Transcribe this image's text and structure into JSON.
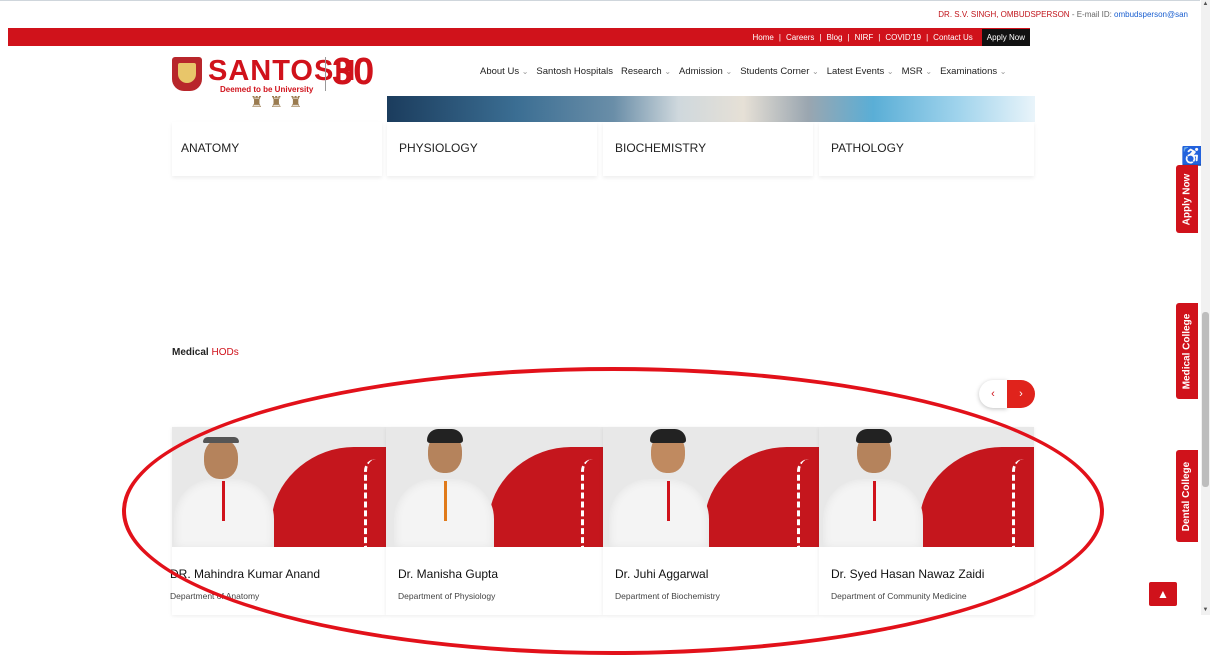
{
  "topinfo": {
    "ombudsperson": "DR. S.V. SINGH, OMBUDSPERSON",
    "email_label": "- E-mail ID:",
    "email": "ombudsperson@san"
  },
  "topnav": {
    "links": [
      "Home",
      "Careers",
      "Blog",
      "NIRF",
      "COVID'19",
      "Contact Us"
    ],
    "apply": "Apply Now"
  },
  "logo": {
    "name": "SANTOSH",
    "subtitle": "Deemed to be University",
    "anniversary": "30"
  },
  "mainnav": {
    "items": [
      "About Us",
      "Santosh Hospitals",
      "Research",
      "Admission",
      "Students Corner",
      "Latest Events",
      "MSR",
      "Examinations"
    ]
  },
  "departments": [
    "ANATOMY",
    "PHYSIOLOGY",
    "BIOCHEMISTRY",
    "PATHOLOGY"
  ],
  "hods": {
    "title_prefix": "Medical",
    "title_accent": "HODs",
    "prev_icon": "chevron-left-icon",
    "next_icon": "chevron-right-icon",
    "doctors": [
      {
        "name": "DR. Mahindra Kumar Anand",
        "department": "Department of Anatomy"
      },
      {
        "name": "Dr. Manisha Gupta",
        "department": "Department of Physiology"
      },
      {
        "name": "Dr. Juhi Aggarwal",
        "department": "Department of Biochemistry"
      },
      {
        "name": "Dr. Syed Hasan Nawaz Zaidi",
        "department": "Department of Community Medicine"
      }
    ]
  },
  "sidetabs": {
    "apply": "Apply Now",
    "medical": "Medical College",
    "dental": "Dental College"
  },
  "icons": {
    "accessibility": "accessibility-icon",
    "scroll_top": "arrow-up-icon"
  },
  "colors": {
    "brand_red": "#d0121b",
    "annotation_red": "#e2111a"
  }
}
